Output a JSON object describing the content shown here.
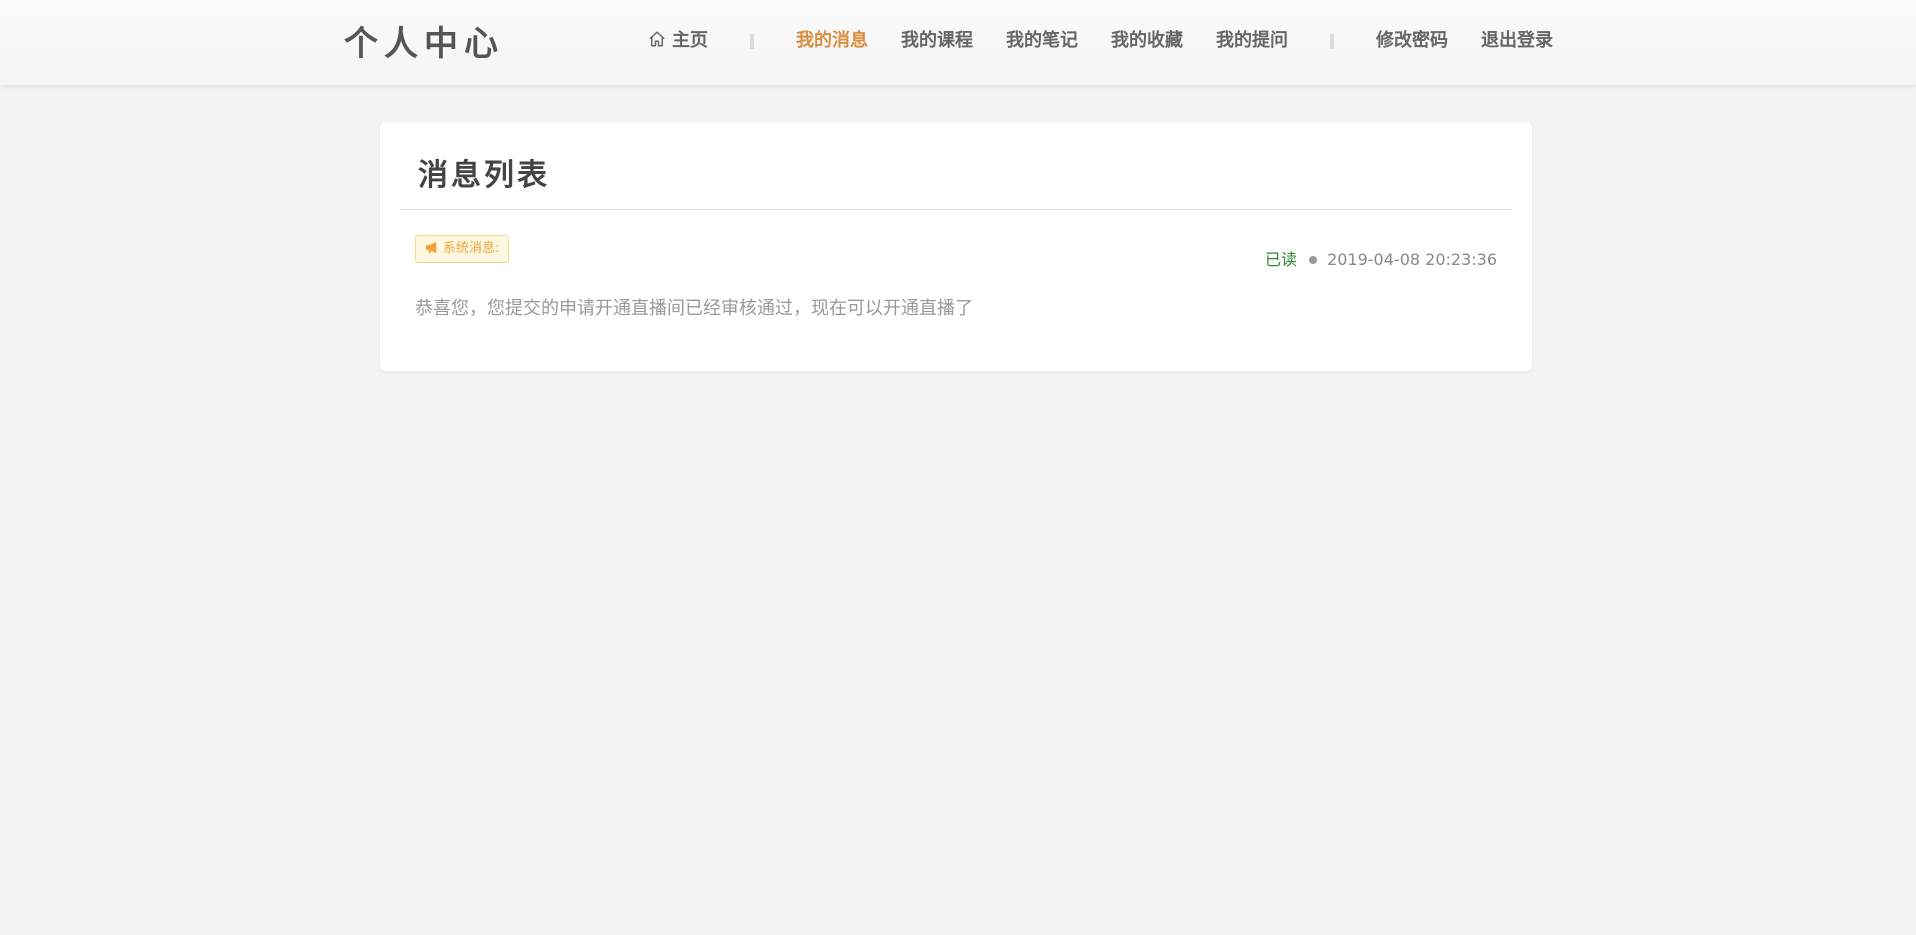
{
  "header": {
    "logo": "个人中心",
    "nav": {
      "home": "主页",
      "items": [
        "我的消息",
        "我的课程",
        "我的笔记",
        "我的收藏",
        "我的提问"
      ],
      "account": [
        "修改密码",
        "退出登录"
      ]
    }
  },
  "main": {
    "title": "消息列表",
    "messages": [
      {
        "tag": "系统消息:",
        "status": "已读",
        "time": "2019-04-08 20:23:36",
        "content": "恭喜您，您提交的申请开通直播间已经审核通过，现在可以开通直播了"
      }
    ]
  },
  "colors": {
    "accent": "#d98e3f",
    "read": "#2f8a2f",
    "badge_text": "#f0a33a",
    "badge_bg": "#fff8e0",
    "page_bg": "#f3f5f4"
  },
  "icons": {
    "home": "home-icon",
    "badge": "megaphone-icon"
  }
}
